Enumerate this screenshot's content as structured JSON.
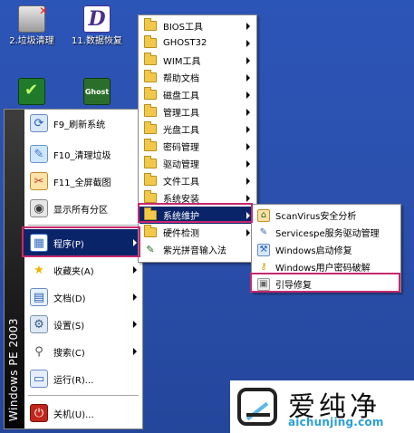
{
  "desktop": {
    "icons": [
      {
        "label": "2.垃圾清理"
      },
      {
        "label": "11.数据恢复"
      },
      {
        "label": ""
      },
      {
        "label": ""
      }
    ]
  },
  "icon_glyphs": {
    "recover_letter": "D",
    "ghost_text": "Ghost"
  },
  "start_menu": {
    "banner": "Windows PE 2003",
    "items": [
      {
        "label": "F9_刷新系统",
        "icon": "refresh-icon"
      },
      {
        "label": "F10_清理垃圾",
        "icon": "cleanup-icon"
      },
      {
        "label": "F11_全屏截图",
        "icon": "screenshot-icon"
      },
      {
        "label": "显示所有分区",
        "icon": "partition-icon"
      },
      {
        "label": "程序(P)",
        "icon": "programs-icon",
        "selected": true
      },
      {
        "label": "收藏夹(A)",
        "icon": "favorites-icon"
      },
      {
        "label": "文档(D)",
        "icon": "documents-icon"
      },
      {
        "label": "设置(S)",
        "icon": "settings-icon"
      },
      {
        "label": "搜索(C)",
        "icon": "search-icon"
      },
      {
        "label": "运行(R)...",
        "icon": "run-icon"
      },
      {
        "label": "关机(U)...",
        "icon": "power-icon"
      }
    ]
  },
  "programs_menu": {
    "items": [
      {
        "label": "BIOS工具",
        "has_submenu": true
      },
      {
        "label": "GHOST32",
        "has_submenu": true
      },
      {
        "label": "WIM工具",
        "has_submenu": true
      },
      {
        "label": "帮助文档",
        "has_submenu": true
      },
      {
        "label": "磁盘工具",
        "has_submenu": true
      },
      {
        "label": "管理工具",
        "has_submenu": true
      },
      {
        "label": "光盘工具",
        "has_submenu": true
      },
      {
        "label": "密码管理",
        "has_submenu": true
      },
      {
        "label": "驱动管理",
        "has_submenu": true
      },
      {
        "label": "文件工具",
        "has_submenu": true
      },
      {
        "label": "系统安装",
        "has_submenu": true
      },
      {
        "label": "系统维护",
        "has_submenu": true,
        "selected": true
      },
      {
        "label": "硬件检测",
        "has_submenu": true
      },
      {
        "label": "紫光拼音输入法",
        "has_submenu": false
      }
    ]
  },
  "maintenance_menu": {
    "items": [
      {
        "label": "ScanVirus安全分析",
        "icon": "virus-scan-icon"
      },
      {
        "label": "Servicespe服务驱动管理",
        "icon": "driver-icon"
      },
      {
        "label": "Windows启动修复",
        "icon": "windows-repair-icon"
      },
      {
        "label": "Windows用户密码破解",
        "icon": "key-icon"
      },
      {
        "label": "引导修复",
        "icon": "boot-repair-icon",
        "highlighted": true
      }
    ]
  },
  "watermark": {
    "name": "爱纯净",
    "url": "aichunjing.com"
  },
  "colors": {
    "desktop_bg": "#2b50ad",
    "selection": "#0a246a",
    "highlight_box": "#c6286e"
  }
}
